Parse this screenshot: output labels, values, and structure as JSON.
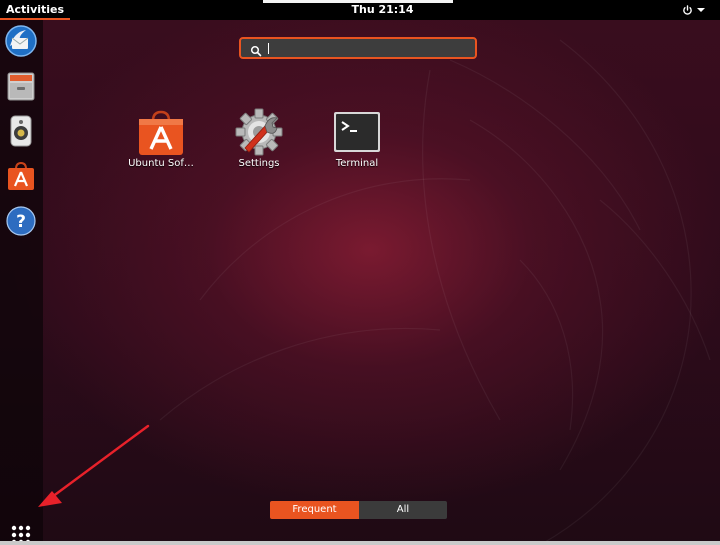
{
  "topbar": {
    "activities_label": "Activities",
    "clock": "Thu 21:14"
  },
  "dock": {
    "items": [
      {
        "name": "thunderbird",
        "icon": "thunderbird-mail-icon"
      },
      {
        "name": "files",
        "icon": "file-cabinet-icon"
      },
      {
        "name": "rhythmbox",
        "icon": "speaker-icon"
      },
      {
        "name": "ubuntu-software",
        "icon": "shopping-bag-icon"
      },
      {
        "name": "help",
        "icon": "question-mark-icon"
      }
    ],
    "show_apps_icon": "grid-dots-icon"
  },
  "search": {
    "value": "",
    "placeholder": ""
  },
  "apps": [
    {
      "label": "Ubuntu Sof…",
      "icon": "ubuntu-software-icon"
    },
    {
      "label": "Settings",
      "icon": "settings-gear-icon"
    },
    {
      "label": "Terminal",
      "icon": "terminal-icon"
    }
  ],
  "view_toggle": {
    "frequent": "Frequent",
    "all": "All",
    "active": "frequent"
  },
  "colors": {
    "accent": "#e95420",
    "topbar": "#000000",
    "annotation_arrow": "#e8212a"
  }
}
